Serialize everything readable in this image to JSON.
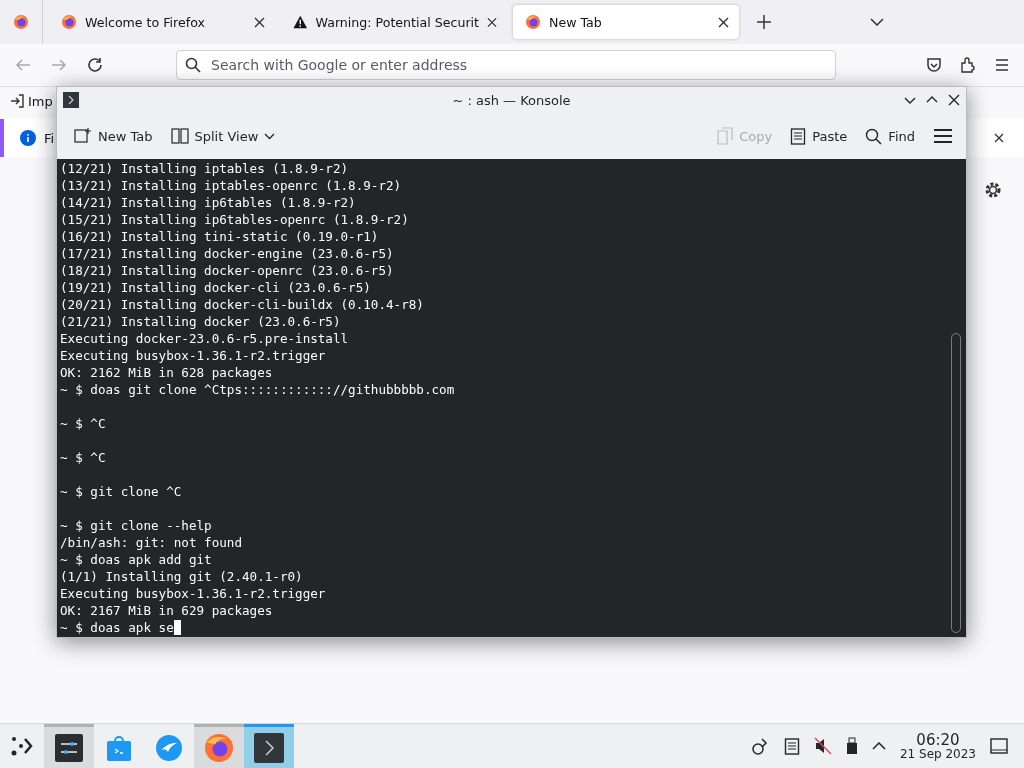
{
  "browser": {
    "tabs": [
      {
        "label": "Welcome to Firefox",
        "kind": "firefox",
        "selected": false
      },
      {
        "label": "Warning: Potential Securit",
        "kind": "warning",
        "selected": false
      },
      {
        "label": "New Tab",
        "kind": "firefox",
        "selected": true
      }
    ],
    "address_bar": {
      "placeholder": "Search with Google or enter address"
    },
    "bookmarks": [
      {
        "label": "Imp"
      }
    ],
    "notification": {
      "text": "Fi"
    }
  },
  "konsole": {
    "title": "~ : ash — Konsole",
    "toolbar": [
      {
        "label": "New Tab",
        "kind": "new-tab",
        "disabled": false
      },
      {
        "label": "Split View",
        "kind": "split",
        "disabled": false
      },
      {
        "label": "Copy",
        "kind": "copy",
        "disabled": true
      },
      {
        "label": "Paste",
        "kind": "paste",
        "disabled": false
      },
      {
        "label": "Find",
        "kind": "find",
        "disabled": false
      }
    ],
    "lines": [
      {
        "text": "(12/21) Installing iptables (1.8.9-r2)",
        "blank_after": false
      },
      {
        "text": "(13/21) Installing iptables-openrc (1.8.9-r2)",
        "blank_after": false
      },
      {
        "text": "(14/21) Installing ip6tables (1.8.9-r2)",
        "blank_after": false
      },
      {
        "text": "(15/21) Installing ip6tables-openrc (1.8.9-r2)",
        "blank_after": false
      },
      {
        "text": "(16/21) Installing tini-static (0.19.0-r1)",
        "blank_after": false
      },
      {
        "text": "(17/21) Installing docker-engine (23.0.6-r5)",
        "blank_after": false
      },
      {
        "text": "(18/21) Installing docker-openrc (23.0.6-r5)",
        "blank_after": false
      },
      {
        "text": "(19/21) Installing docker-cli (23.0.6-r5)",
        "blank_after": false
      },
      {
        "text": "(20/21) Installing docker-cli-buildx (0.10.4-r8)",
        "blank_after": false
      },
      {
        "text": "(21/21) Installing docker (23.0.6-r5)",
        "blank_after": false
      },
      {
        "text": "Executing docker-23.0.6-r5.pre-install",
        "blank_after": false
      },
      {
        "text": "Executing busybox-1.36.1-r2.trigger",
        "blank_after": false
      },
      {
        "text": "OK: 2162 MiB in 628 packages",
        "blank_after": false
      },
      {
        "text": "~ $ doas git clone ^Ctps:::::::::::://githubbbbb.com",
        "blank_after": true
      },
      {
        "text": "~ $ ^C",
        "blank_after": true
      },
      {
        "text": "~ $ ^C",
        "blank_after": true
      },
      {
        "text": "~ $ git clone ^C",
        "blank_after": true
      },
      {
        "text": "~ $ git clone --help",
        "blank_after": false
      },
      {
        "text": "/bin/ash: git: not found",
        "blank_after": false
      },
      {
        "text": "~ $ doas apk add git",
        "blank_after": false
      },
      {
        "text": "(1/1) Installing git (2.40.1-r0)",
        "blank_after": false
      },
      {
        "text": "Executing busybox-1.36.1-r2.trigger",
        "blank_after": false
      },
      {
        "text": "OK: 2167 MiB in 629 packages",
        "blank_after": false
      },
      {
        "text": "~ $ doas apk se",
        "blank_after": false
      }
    ]
  },
  "taskbar": {
    "apps": [
      {
        "kind": "settings",
        "selected": false,
        "running": true
      },
      {
        "kind": "store",
        "selected": false,
        "running": false
      },
      {
        "kind": "bird",
        "selected": false,
        "running": false
      },
      {
        "kind": "firefox",
        "selected": false,
        "running": true
      },
      {
        "kind": "terminal",
        "selected": true,
        "running": true
      }
    ],
    "clock": {
      "time": "06:20",
      "date": "21 Sep 2023"
    }
  }
}
